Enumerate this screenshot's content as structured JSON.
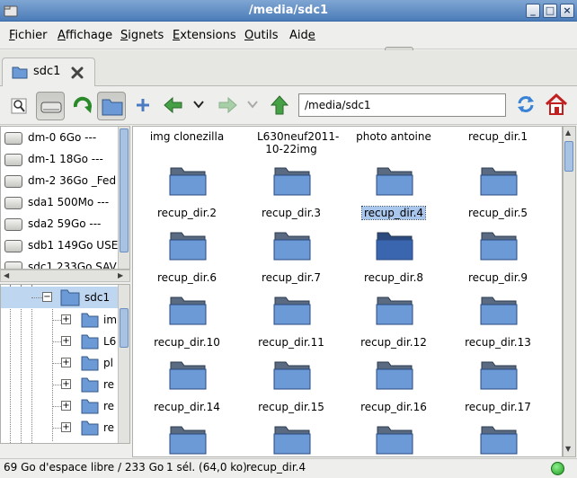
{
  "window": {
    "title": "/media/sdc1",
    "buttons": [
      "minimize",
      "maximize",
      "close"
    ]
  },
  "menubar": {
    "items": [
      {
        "first": "F",
        "rest": "ichier"
      },
      {
        "first": "A",
        "rest": "ffichage"
      },
      {
        "first": "S",
        "rest": "ignets"
      },
      {
        "first": "E",
        "rest": "xtensions"
      },
      {
        "first": "O",
        "rest": "utils"
      },
      {
        "first": "Ai",
        "rest": "d",
        "last": "e"
      }
    ]
  },
  "tab": {
    "label": "sdc1"
  },
  "toolbar": {
    "path": "/media/sdc1"
  },
  "devices": [
    {
      "label": "dm-0 6Go ---"
    },
    {
      "label": "dm-1 18Go ---"
    },
    {
      "label": "dm-2 36Go _Fed"
    },
    {
      "label": "sda1 500Mo ---"
    },
    {
      "label": "sda2 59Go ---"
    },
    {
      "label": "sdb1 149Go USE"
    },
    {
      "label": "sdc1 233Go SAV"
    }
  ],
  "tree": {
    "root": "sdc1",
    "children": [
      {
        "label": "im"
      },
      {
        "label": "L6"
      },
      {
        "label": "pl"
      },
      {
        "label": "re"
      },
      {
        "label": "re"
      },
      {
        "label": "re"
      }
    ]
  },
  "files": {
    "top_row": [
      "img clonezilla",
      "L630neuf2011-10-22img",
      "photo antoine",
      "recup_dir.1"
    ],
    "rows": [
      [
        "recup_dir.2",
        "recup_dir.3",
        "recup_dir.4",
        "recup_dir.5"
      ],
      [
        "recup_dir.6",
        "recup_dir.7",
        "recup_dir.8",
        "recup_dir.9"
      ],
      [
        "recup_dir.10",
        "recup_dir.11",
        "recup_dir.12",
        "recup_dir.13"
      ],
      [
        "recup_dir.14",
        "recup_dir.15",
        "recup_dir.16",
        "recup_dir.17"
      ]
    ],
    "selected": "recup_dir.4"
  },
  "status": {
    "free_space": "69 Go d'espace libre / 233 Go",
    "selection": "1 sél. (64,0 ko)",
    "current": "recup_dir.4"
  },
  "colors": {
    "titlebar": "#5a88c2",
    "folder": "#6c9ad6",
    "selected": "#3a66b0",
    "lamp_green": "#3cc43c"
  }
}
